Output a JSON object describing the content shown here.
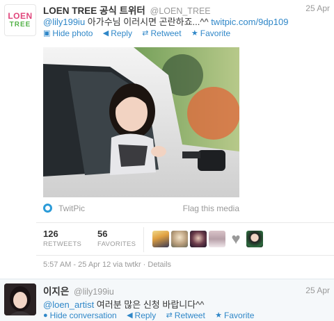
{
  "tweet1": {
    "avatar_logo_top": "LOEN",
    "avatar_logo_bottom": "TREE",
    "fullname": "LOEN TREE 공식 트위터",
    "handle": "@LOEN_TREE",
    "date": "25 Apr",
    "mention": "@lily199iu",
    "text": " 아가수님 이러시면 곤란하죠...^^ ",
    "link": "twitpic.com/9dp109",
    "actions": {
      "hide_photo": "Hide photo",
      "reply": "Reply",
      "retweet": "Retweet",
      "favorite": "Favorite"
    },
    "media": {
      "provider": "TwitPic",
      "flag": "Flag this media"
    },
    "stats": {
      "retweets_count": "126",
      "retweets_label": "RETWEETS",
      "favorites_count": "56",
      "favorites_label": "FAVORITES"
    },
    "meta": "5:57 AM - 25 Apr 12 via twtkr · Details"
  },
  "tweet2": {
    "fullname": "이지은",
    "handle": "@lily199iu",
    "date": "25 Apr",
    "mention": "@loen_artist",
    "text": " 여러분 많은 신청 바랍니다^^",
    "actions": {
      "hide_conversation": "Hide conversation",
      "reply": "Reply",
      "retweet": "Retweet",
      "favorite": "Favorite"
    }
  },
  "colors": {
    "link": "#2f87c8",
    "muted": "#999999",
    "logo_pink": "#e0457b",
    "logo_green": "#55b34a"
  },
  "icons": [
    "hide-photo-icon",
    "reply-icon",
    "retweet-icon",
    "favorite-icon",
    "twitpic-icon"
  ]
}
